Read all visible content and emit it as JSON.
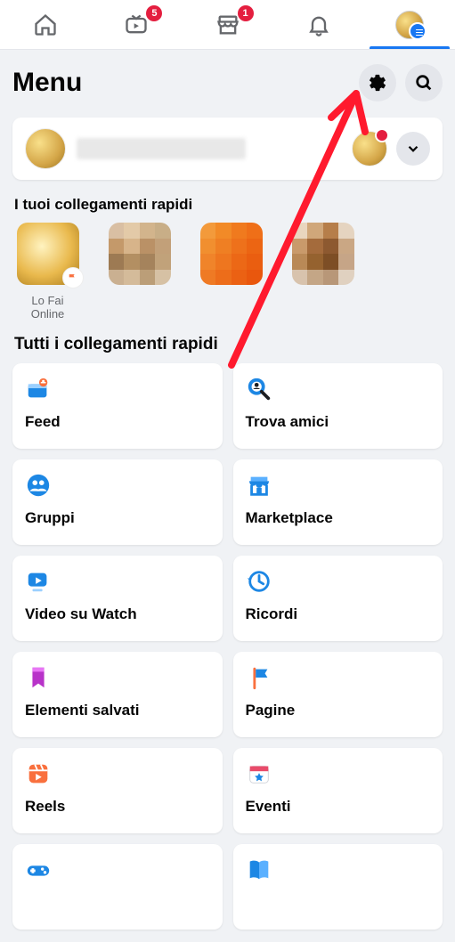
{
  "topnav": {
    "watch_badge": "5",
    "marketplace_badge": "1"
  },
  "header": {
    "title": "Menu"
  },
  "shortcuts": {
    "heading": "I tuoi collegamenti rapidi",
    "items": [
      {
        "label": "Lo Fai Online"
      }
    ]
  },
  "all_shortcuts": {
    "heading": "Tutti i collegamenti rapidi",
    "tiles": [
      {
        "label": "Feed"
      },
      {
        "label": "Trova amici"
      },
      {
        "label": "Gruppi"
      },
      {
        "label": "Marketplace"
      },
      {
        "label": "Video su Watch"
      },
      {
        "label": "Ricordi"
      },
      {
        "label": "Elementi salvati"
      },
      {
        "label": "Pagine"
      },
      {
        "label": "Reels"
      },
      {
        "label": "Eventi"
      },
      {
        "label": ""
      },
      {
        "label": ""
      }
    ]
  }
}
